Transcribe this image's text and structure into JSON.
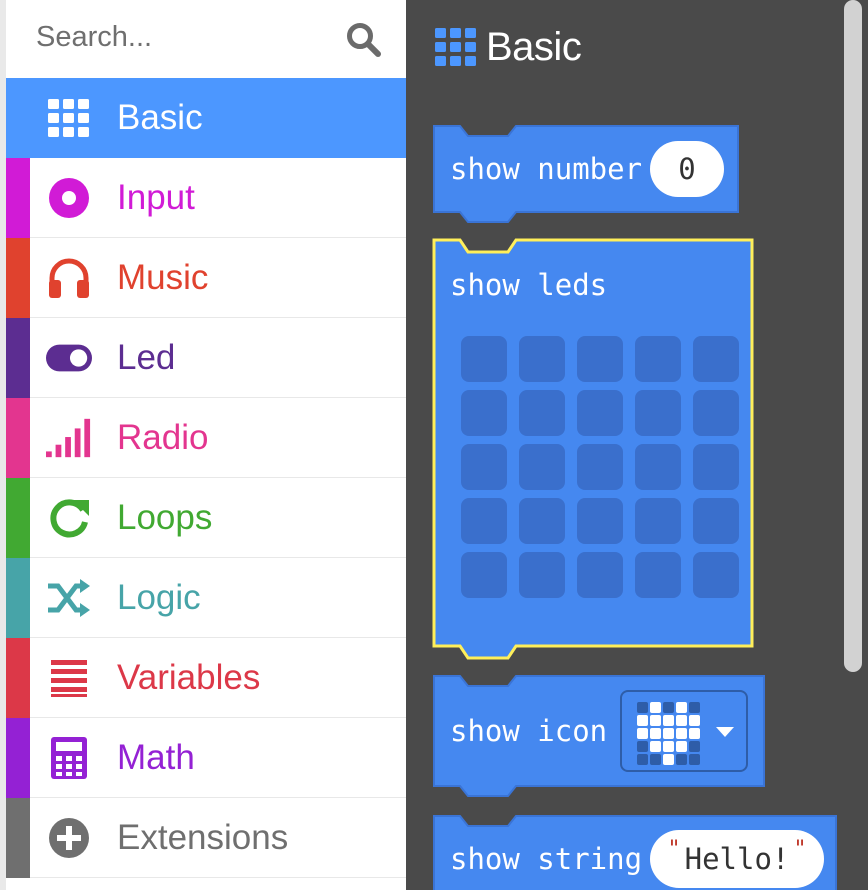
{
  "search": {
    "placeholder": "Search..."
  },
  "categories": [
    {
      "label": "Basic",
      "icon": "grid-icon",
      "color": "#4c97ff",
      "selected": true
    },
    {
      "label": "Input",
      "icon": "input-circle-icon",
      "color": "#d11bd6"
    },
    {
      "label": "Music",
      "icon": "headphones-icon",
      "color": "#e0422e"
    },
    {
      "label": "Led",
      "icon": "toggle-icon",
      "color": "#5c2d91"
    },
    {
      "label": "Radio",
      "icon": "signal-bars-icon",
      "color": "#e3358f"
    },
    {
      "label": "Loops",
      "icon": "refresh-icon",
      "color": "#41a932"
    },
    {
      "label": "Logic",
      "icon": "shuffle-icon",
      "color": "#47a4a8"
    },
    {
      "label": "Variables",
      "icon": "list-lines-icon",
      "color": "#dc3848"
    },
    {
      "label": "Math",
      "icon": "calculator-icon",
      "color": "#9421d4"
    },
    {
      "label": "Extensions",
      "icon": "plus-circle-icon",
      "color": "#6f6f6f"
    }
  ],
  "flyout": {
    "title": "Basic",
    "blocks": {
      "show_number": {
        "label": "show number",
        "value": "0"
      },
      "show_leds": {
        "label": "show leds"
      },
      "show_icon": {
        "label": "show icon"
      },
      "show_string": {
        "label": "show string",
        "value": "Hello!",
        "quote": "\""
      }
    }
  },
  "colors": {
    "block": "#4588f0",
    "block_border": "#3a74d6",
    "highlight": "#ffef5a",
    "flyout_bg": "#4a4a4a"
  }
}
